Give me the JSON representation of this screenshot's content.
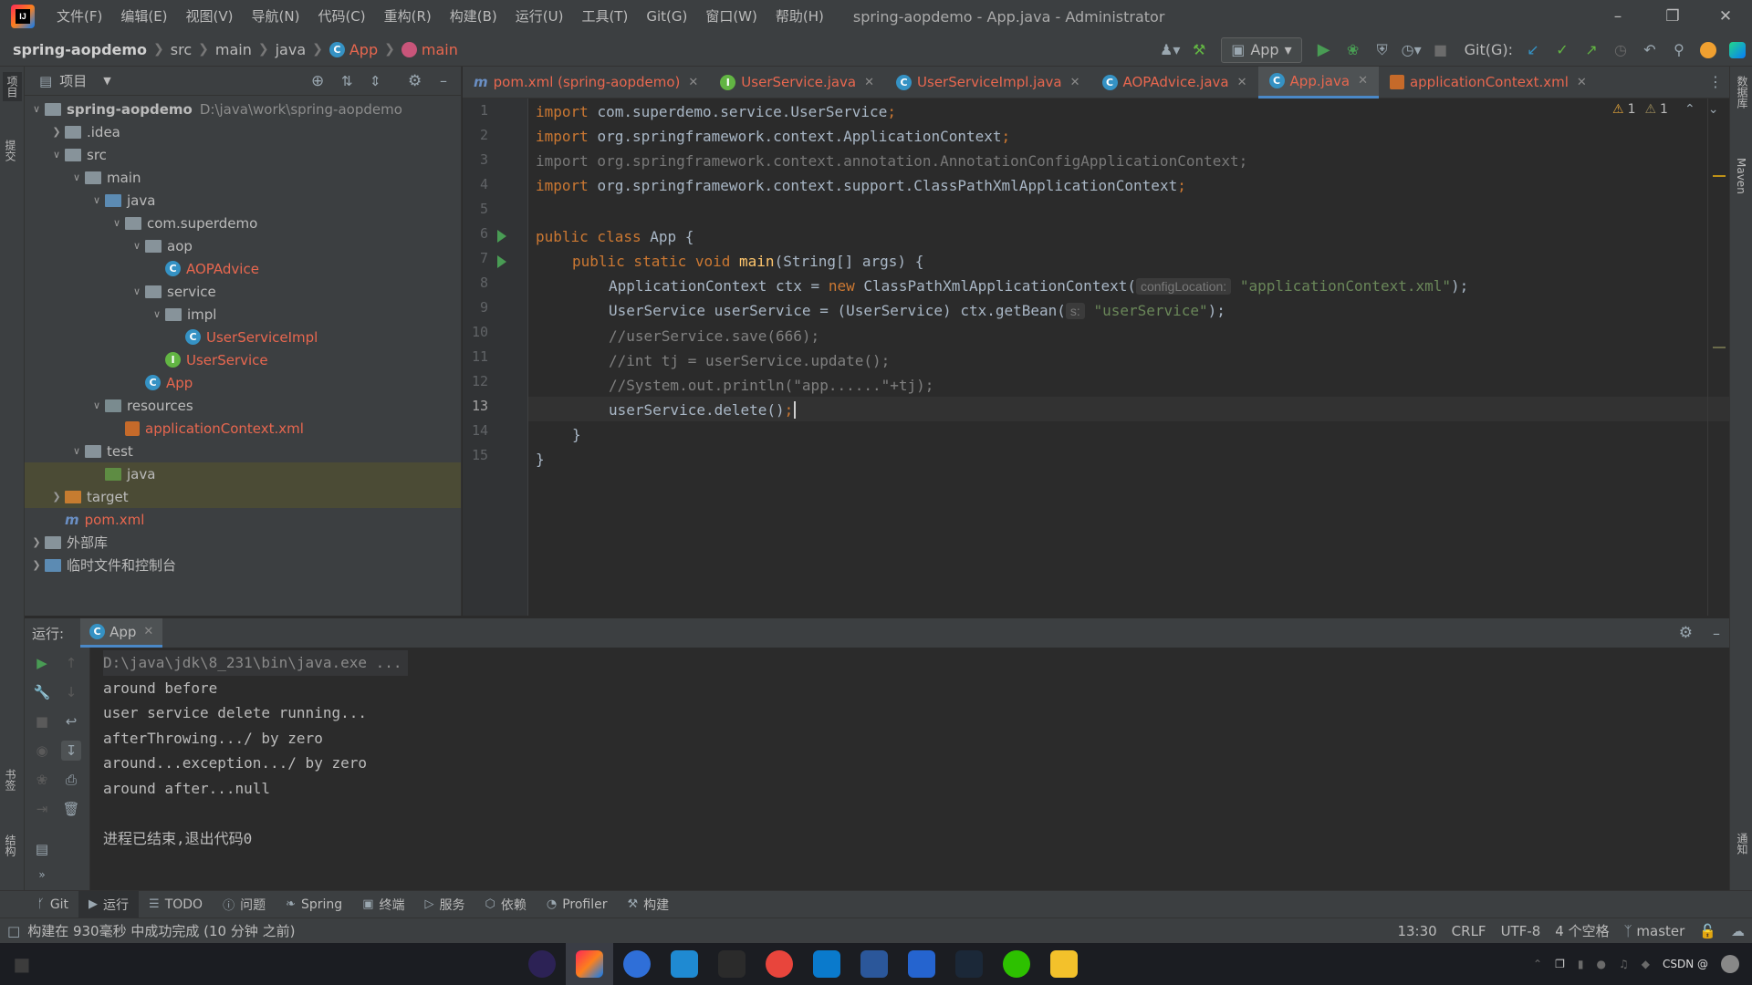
{
  "window": {
    "title": "spring-aopdemo - App.java - Administrator",
    "menu": [
      "文件(F)",
      "编辑(E)",
      "视图(V)",
      "导航(N)",
      "代码(C)",
      "重构(R)",
      "构建(B)",
      "运行(U)",
      "工具(T)",
      "Git(G)",
      "窗口(W)",
      "帮助(H)"
    ]
  },
  "breadcrumb": [
    "spring-aopdemo",
    "src",
    "main",
    "java",
    "App",
    "main"
  ],
  "toolbar": {
    "run_config": "App",
    "git_label": "Git(G):"
  },
  "left_strip": {
    "project": "项目",
    "commit": "提交",
    "bookmarks": "书签",
    "structure": "结构"
  },
  "right_strip": {
    "database": "数据库",
    "maven": "Maven",
    "notifications": "通知"
  },
  "project_panel": {
    "title": "项目",
    "tree": [
      {
        "label": "spring-aopdemo",
        "path": "D:\\java\\work\\spring-aopdemo",
        "depth": 0,
        "arrow": "open",
        "icon": "module-folder",
        "bold": true
      },
      {
        "label": ".idea",
        "depth": 1,
        "arrow": "closed",
        "icon": "folder"
      },
      {
        "label": "src",
        "depth": 1,
        "arrow": "open",
        "icon": "folder"
      },
      {
        "label": "main",
        "depth": 2,
        "arrow": "open",
        "icon": "folder"
      },
      {
        "label": "java",
        "depth": 3,
        "arrow": "open",
        "icon": "source-folder"
      },
      {
        "label": "com.superdemo",
        "depth": 4,
        "arrow": "open",
        "icon": "package"
      },
      {
        "label": "aop",
        "depth": 5,
        "arrow": "open",
        "icon": "package"
      },
      {
        "label": "AOPAdvice",
        "depth": 6,
        "arrow": "none",
        "icon": "class",
        "red": true
      },
      {
        "label": "service",
        "depth": 5,
        "arrow": "open",
        "icon": "package"
      },
      {
        "label": "impl",
        "depth": 6,
        "arrow": "open",
        "icon": "package"
      },
      {
        "label": "UserServiceImpl",
        "depth": 7,
        "arrow": "none",
        "icon": "class",
        "red": true
      },
      {
        "label": "UserService",
        "depth": 6,
        "arrow": "none",
        "icon": "interface",
        "red": true
      },
      {
        "label": "App",
        "depth": 5,
        "arrow": "none",
        "icon": "class-run",
        "red": true
      },
      {
        "label": "resources",
        "depth": 3,
        "arrow": "open",
        "icon": "resource-folder"
      },
      {
        "label": "applicationContext.xml",
        "depth": 4,
        "arrow": "none",
        "icon": "xml",
        "red": true
      },
      {
        "label": "test",
        "depth": 2,
        "arrow": "open",
        "icon": "folder"
      },
      {
        "label": "java",
        "depth": 3,
        "arrow": "none",
        "icon": "test-folder",
        "selected": true
      },
      {
        "label": "target",
        "depth": 1,
        "arrow": "closed",
        "icon": "excluded-folder",
        "selected": true
      },
      {
        "label": "pom.xml",
        "depth": 1,
        "arrow": "none",
        "icon": "maven",
        "red": true
      },
      {
        "label": "外部库",
        "depth": 0,
        "arrow": "closed",
        "icon": "libraries"
      },
      {
        "label": "临时文件和控制台",
        "depth": 0,
        "arrow": "closed",
        "icon": "scratches"
      }
    ]
  },
  "editor_tabs": [
    {
      "label": "pom.xml (spring-aopdemo)",
      "icon": "maven"
    },
    {
      "label": "UserService.java",
      "icon": "interface"
    },
    {
      "label": "UserServiceImpl.java",
      "icon": "class"
    },
    {
      "label": "AOPAdvice.java",
      "icon": "class"
    },
    {
      "label": "App.java",
      "icon": "class",
      "active": true
    },
    {
      "label": "applicationContext.xml",
      "icon": "xml"
    }
  ],
  "inspection": {
    "warnings": "1",
    "weak_warnings": "1"
  },
  "code": {
    "line_numbers": [
      "1",
      "2",
      "3",
      "4",
      "5",
      "6",
      "7",
      "8",
      "9",
      "10",
      "11",
      "12",
      "13",
      "14",
      "15"
    ],
    "l1": {
      "kw": "import ",
      "rest": "com.superdemo.service.UserService",
      "semi": ";"
    },
    "l2": {
      "kw": "import ",
      "rest": "org.springframework.context.ApplicationContext",
      "semi": ";"
    },
    "l3": "import org.springframework.context.annotation.AnnotationConfigApplicationContext;",
    "l4": {
      "kw": "import ",
      "rest": "org.springframework.context.support.ClassPathXmlApplicationContext",
      "semi": ";"
    },
    "l6": {
      "kw": "public class ",
      "rest": "App {"
    },
    "l7": {
      "kw": "public static void ",
      "fn": "main",
      "rest": "(String[] args) {"
    },
    "l8": {
      "a": "ApplicationContext ctx = ",
      "kw": "new ",
      "b": "ClassPathXmlApplicationContext(",
      "hint": "configLocation:",
      "str": "\"applicationContext.xml\"",
      "c": ");"
    },
    "l9": {
      "a": "UserService userService = (UserService) ctx.getBean(",
      "hint": "s:",
      "str": "\"userService\"",
      "c": ");"
    },
    "l10": "//userService.save(666);",
    "l11": "//int tj = userService.update();",
    "l12": "//System.out.println(\"app......\"+tj);",
    "l13": {
      "a": "userService.delete()",
      "semi": ";"
    },
    "l14": "}",
    "l15": "}"
  },
  "run_panel": {
    "label": "运行:",
    "tab": "App",
    "console": [
      "D:\\java\\jdk\\8_231\\bin\\java.exe ...",
      "around before",
      "user service delete running...",
      "afterThrowing.../ by zero",
      "around...exception.../ by zero",
      "around after...null",
      "",
      "进程已结束,退出代码0"
    ]
  },
  "tool_tabs": [
    {
      "label": "Git",
      "icon": "git-icon"
    },
    {
      "label": "运行",
      "icon": "run-icon",
      "active": true
    },
    {
      "label": "TODO",
      "icon": "todo-icon"
    },
    {
      "label": "问题",
      "icon": "problems-icon"
    },
    {
      "label": "Spring",
      "icon": "spring-icon"
    },
    {
      "label": "终端",
      "icon": "terminal-icon"
    },
    {
      "label": "服务",
      "icon": "services-icon"
    },
    {
      "label": "依赖",
      "icon": "dependencies-icon"
    },
    {
      "label": "Profiler",
      "icon": "profiler-icon"
    },
    {
      "label": "构建",
      "icon": "build-icon"
    }
  ],
  "status": {
    "message": "构建在 930毫秒 中成功完成 (10 分钟 之前)",
    "position": "13:30",
    "line_sep": "CRLF",
    "encoding": "UTF-8",
    "indent": "4 个空格",
    "branch": "master"
  },
  "taskbar": {
    "apps": [
      "eclipse",
      "intellij-idea",
      "browser-edge",
      "task-app",
      "terminal",
      "chrome",
      "vscode",
      "word",
      "todo",
      "steam",
      "wechat",
      "file-explorer"
    ],
    "tray_text": "CSDN @"
  },
  "colors": {
    "accent": "#4a88c7",
    "error_red": "#e8674f",
    "keyword": "#cc7832",
    "string": "#6a8759"
  }
}
